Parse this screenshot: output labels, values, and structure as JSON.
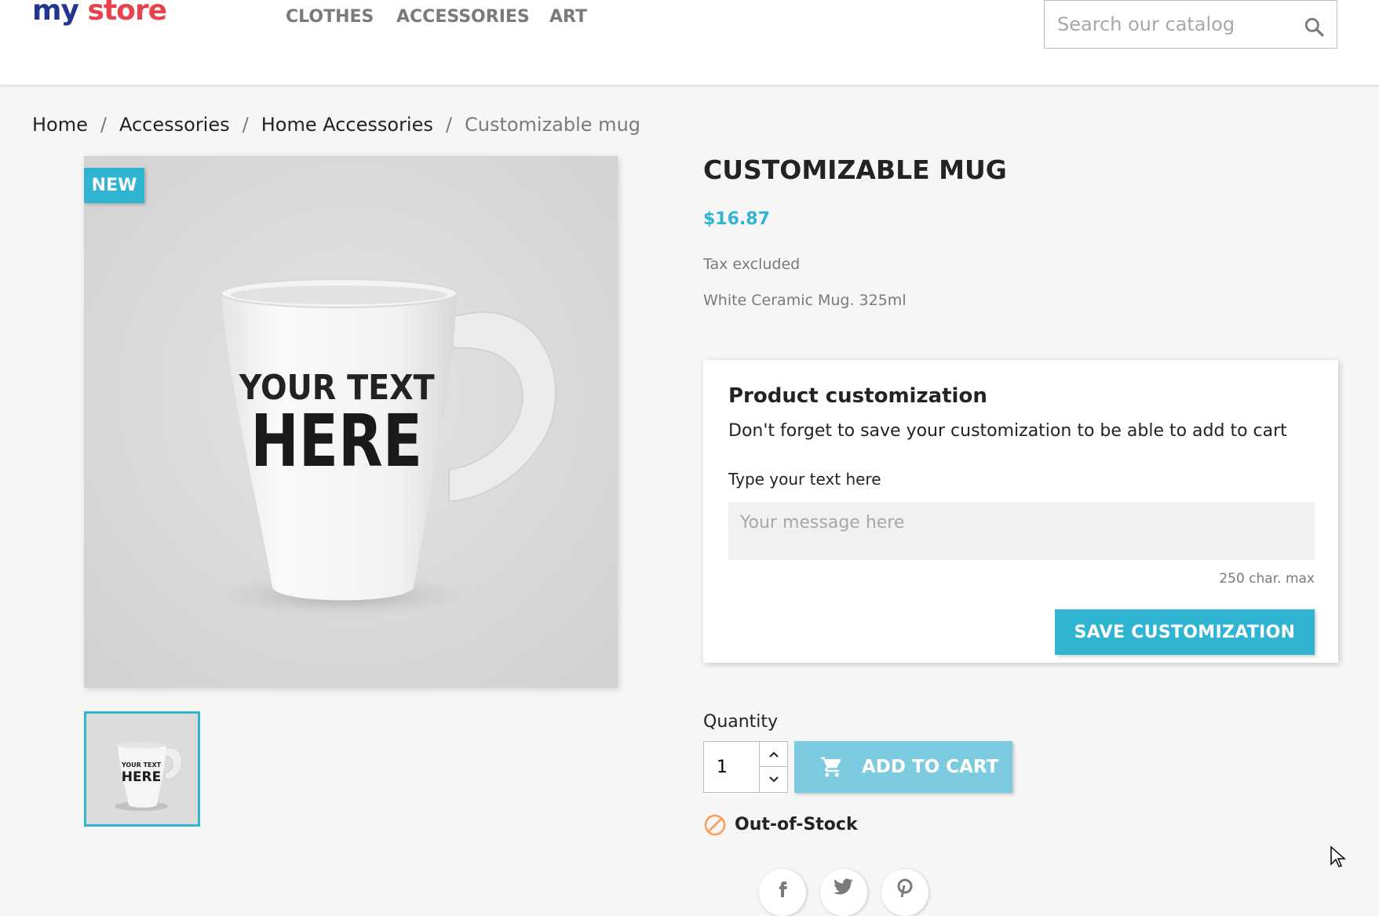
{
  "header": {
    "logo": {
      "my": "my",
      "store": "store"
    },
    "nav": [
      "CLOTHES",
      "ACCESSORIES",
      "ART"
    ],
    "search_placeholder": "Search our catalog"
  },
  "breadcrumb": [
    "Home",
    "Accessories",
    "Home Accessories",
    "Customizable mug"
  ],
  "product": {
    "badge": "NEW",
    "image_text": {
      "line1": "YOUR TEXT",
      "line2": "HERE"
    },
    "title": "CUSTOMIZABLE MUG",
    "price": "$16.87",
    "tax": "Tax excluded",
    "description": "White Ceramic Mug. 325ml"
  },
  "customization": {
    "heading": "Product customization",
    "note": "Don't forget to save your customization to be able to add to cart",
    "field_label": "Type your text here",
    "placeholder": "Your message here",
    "max": "250 char. max",
    "save_label": "SAVE CUSTOMIZATION"
  },
  "purchase": {
    "quantity_label": "Quantity",
    "quantity_value": "1",
    "add_to_cart": "ADD TO CART",
    "stock_status": "Out-of-Stock"
  },
  "colors": {
    "accent": "#2fb5d2",
    "add_to_cart_disabled": "#7ccbe0",
    "out_of_stock": "#ff9a52"
  },
  "icons": [
    "search-icon",
    "cart-icon",
    "out-of-stock-icon",
    "facebook-icon",
    "twitter-icon",
    "pinterest-icon"
  ]
}
